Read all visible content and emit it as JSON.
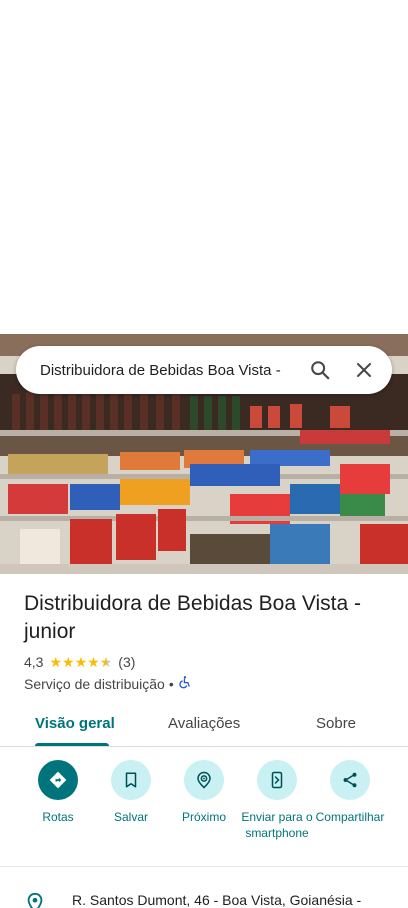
{
  "search": {
    "query": "Distribuidora de Bebidas Boa Vista - "
  },
  "place": {
    "name": "Distribuidora de Bebidas Boa Vista - junior",
    "rating": "4,3",
    "rating_value": 4.3,
    "review_count": "(3)",
    "category": "Serviço de distribuição",
    "separator": "•",
    "accessible": true
  },
  "tabs": [
    {
      "label": "Visão geral",
      "active": true
    },
    {
      "label": "Avaliações",
      "active": false
    },
    {
      "label": "Sobre",
      "active": false
    }
  ],
  "actions": [
    {
      "label": "Rotas",
      "icon": "directions-icon"
    },
    {
      "label": "Salvar",
      "icon": "bookmark-icon"
    },
    {
      "label": "Próximo",
      "icon": "nearby-icon"
    },
    {
      "label": "Enviar para o smartphone",
      "icon": "send-to-phone-icon"
    },
    {
      "label": "Compartilhar",
      "icon": "share-icon"
    }
  ],
  "address": {
    "text": "R. Santos Dumont, 46 - Boa Vista, Goianésia -",
    "icon": "location-pin-icon"
  },
  "colors": {
    "accent": "#00747c",
    "action_bg": "#c9f0f3",
    "star": "#fbbc04"
  }
}
